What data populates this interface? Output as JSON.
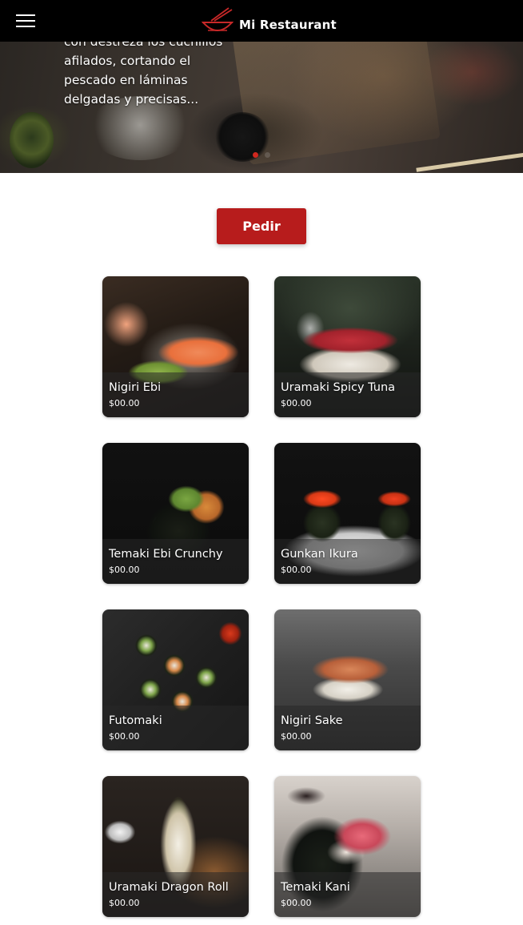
{
  "navbar": {
    "brand_name": "Mi Restaurant",
    "menu_icon": "hamburger-menu-icon",
    "logo_icon": "bowl-chopsticks-logo-icon",
    "logo_color": "#c62828",
    "background": "#000000"
  },
  "hero": {
    "text_line1": "con destreza los cuchillos",
    "text_line2": "afilados, cortando el",
    "text_line3": "pescado en láminas",
    "text_line4": "delgadas y precisas...",
    "carousel_active_dot_color": "#d0281f"
  },
  "actions": {
    "order_label": "Pedir",
    "order_color": "#b71c1c"
  },
  "menu": {
    "items": [
      {
        "name": "Nigiri Ebi",
        "price": "$00.00"
      },
      {
        "name": "Uramaki Spicy Tuna",
        "price": "$00.00"
      },
      {
        "name": "Temaki Ebi Crunchy",
        "price": "$00.00"
      },
      {
        "name": "Gunkan Ikura",
        "price": "$00.00"
      },
      {
        "name": "Futomaki",
        "price": "$00.00"
      },
      {
        "name": "Nigiri Sake",
        "price": "$00.00"
      },
      {
        "name": "Uramaki Dragon Roll",
        "price": "$00.00"
      },
      {
        "name": "Temaki Kani",
        "price": "$00.00"
      }
    ]
  }
}
